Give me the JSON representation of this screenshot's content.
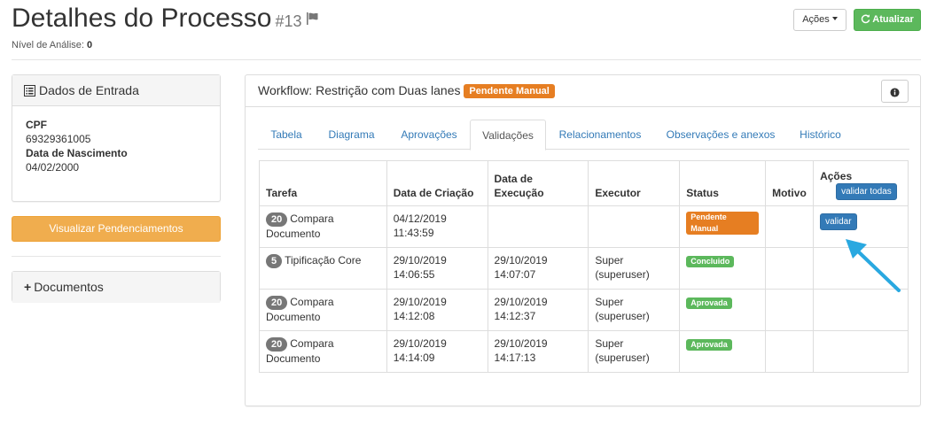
{
  "header": {
    "title": "Detalhes do Processo",
    "process_id": "#13",
    "analysis_label": "Nível de Análise:",
    "analysis_value": "0",
    "actions_label": "Ações",
    "refresh_label": "Atualizar"
  },
  "entry_panel": {
    "title": "Dados de Entrada",
    "fields": [
      {
        "label": "CPF",
        "value": "69329361005"
      },
      {
        "label": "Data de Nascimento",
        "value": "04/02/2000"
      }
    ]
  },
  "pendencies_button": "Visualizar Pendenciamentos",
  "documents_panel": {
    "title": "Documentos"
  },
  "workflow": {
    "title": "Workflow: Restrição com Duas lanes",
    "status_label": "Pendente Manual",
    "tabs": [
      {
        "label": "Tabela"
      },
      {
        "label": "Diagrama"
      },
      {
        "label": "Aprovações"
      },
      {
        "label": "Validações"
      },
      {
        "label": "Relacionamentos"
      },
      {
        "label": "Observações e anexos"
      },
      {
        "label": "Histórico"
      }
    ],
    "active_tab": "Validações"
  },
  "validations_table": {
    "columns": {
      "task": "Tarefa",
      "created": "Data de Criação",
      "executed": "Data de Execução",
      "executor": "Executor",
      "status": "Status",
      "reason": "Motivo",
      "actions": "Ações"
    },
    "validate_all_label": "validar todas",
    "rows": [
      {
        "badge": "20",
        "task": "Compara Documento",
        "created": "04/12/2019 11:43:59",
        "executed": "",
        "executor": "",
        "status": "Pendente Manual",
        "status_color": "#e67e22",
        "reason": "",
        "action": "validar"
      },
      {
        "badge": "5",
        "task": "Tipificação Core",
        "created": "29/10/2019 14:06:55",
        "executed": "29/10/2019 14:07:07",
        "executor": "Super (superuser)",
        "status": "Concluido",
        "status_color": "#5cb85c",
        "reason": "",
        "action": ""
      },
      {
        "badge": "20",
        "task": "Compara Documento",
        "created": "29/10/2019 14:12:08",
        "executed": "29/10/2019 14:12:37",
        "executor": "Super (superuser)",
        "status": "Aprovada",
        "status_color": "#5cb85c",
        "reason": "",
        "action": ""
      },
      {
        "badge": "20",
        "task": "Compara Documento",
        "created": "29/10/2019 14:14:09",
        "executed": "29/10/2019 14:17:13",
        "executor": "Super (superuser)",
        "status": "Aprovada",
        "status_color": "#5cb85c",
        "reason": "",
        "action": ""
      }
    ]
  },
  "colors": {
    "primary": "#337ab7",
    "success": "#5cb85c",
    "warning": "#f0ad4e",
    "pending": "#e67e22",
    "arrow": "#29a8e0"
  }
}
